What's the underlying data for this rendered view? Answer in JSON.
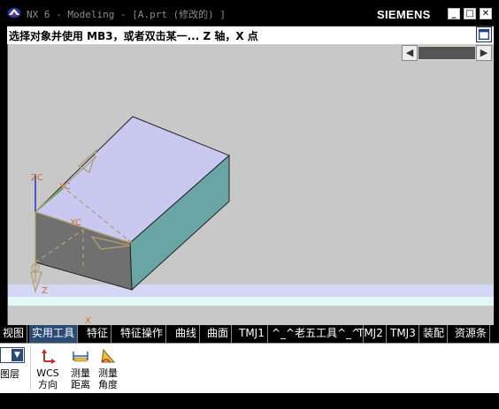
{
  "window": {
    "title": "NX 6 - Modeling - [A.prt (修改的) ]",
    "brand": "SIEMENS",
    "buttons": {
      "minimize": "_",
      "maximize": "□",
      "close": "✕"
    }
  },
  "prompt": {
    "text": "选择对象并使用 MB3，或者双击某一... Z 轴，X 点"
  },
  "viewport": {
    "axes": {
      "zc": "ZC",
      "yc": "YC",
      "xc": "XC",
      "y": "Y",
      "z": "Z",
      "x": "X"
    },
    "colors": {
      "top_face": "#c8c8f0",
      "right_face": "#6aa5a5",
      "front_face": "#707070",
      "background": "#c8c8c8",
      "floor": "#dfe8ff"
    }
  },
  "tabs": [
    {
      "label": "视图",
      "active": false
    },
    {
      "label": "实用工具",
      "active": true
    },
    {
      "label": "特征",
      "active": false
    },
    {
      "label": "特征操作",
      "active": false
    },
    {
      "label": "曲线",
      "active": false
    },
    {
      "label": "曲面",
      "active": false
    },
    {
      "label": "TMJ1",
      "active": false
    },
    {
      "label": "^_^老五工具^_^",
      "active": false
    },
    {
      "label": "TMJ2",
      "active": false
    },
    {
      "label": "TMJ3",
      "active": false
    },
    {
      "label": "装配",
      "active": false
    },
    {
      "label": "资源条",
      "active": false
    }
  ],
  "toolbar": {
    "layer_label": "图层",
    "items": [
      {
        "line1": "WCS",
        "line2": "方向",
        "icon": "wcs-orient-icon"
      },
      {
        "line1": "测量",
        "line2": "距离",
        "icon": "measure-distance-icon"
      },
      {
        "line1": "测量",
        "line2": "角度",
        "icon": "measure-angle-icon"
      }
    ]
  }
}
